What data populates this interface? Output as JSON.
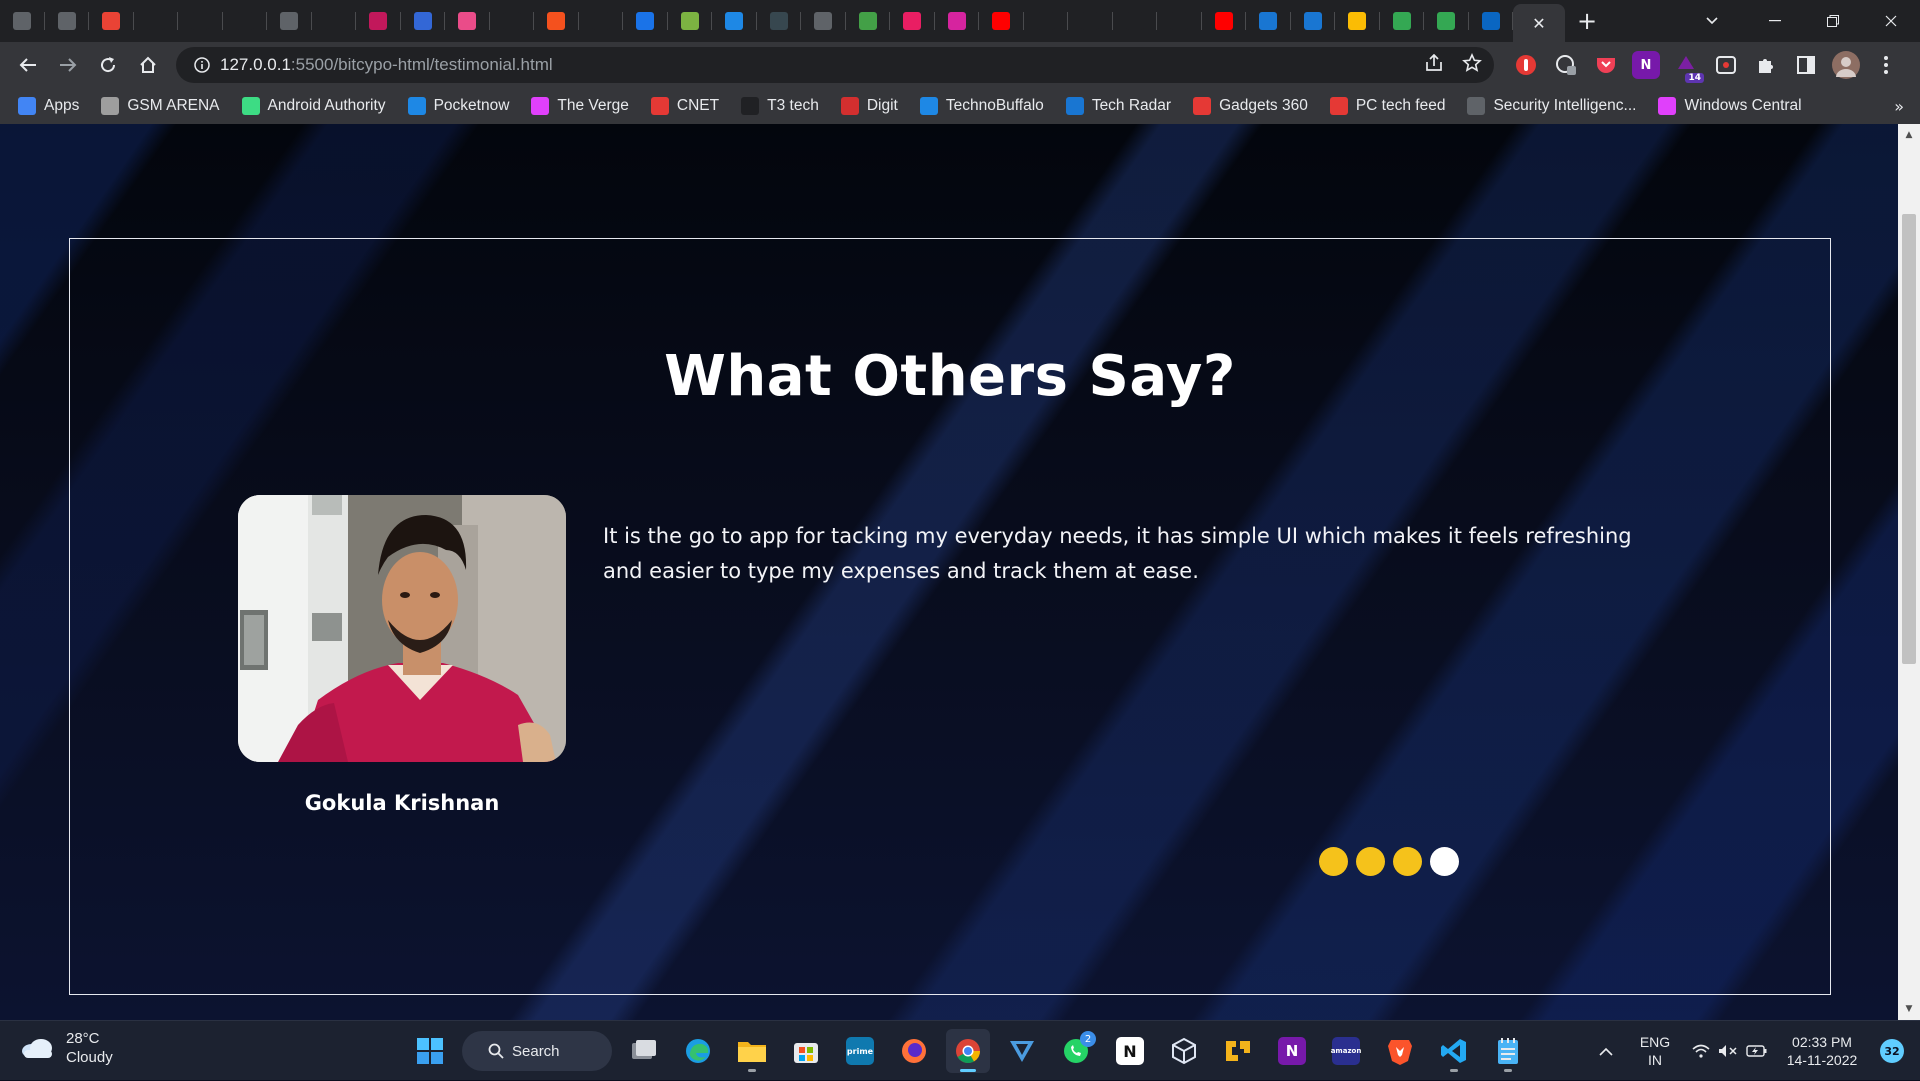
{
  "browser": {
    "tabs": [
      {
        "icon": "tab-favicon-app",
        "color": "#5f6368"
      },
      {
        "icon": "tab-favicon-download",
        "color": "#5f6368"
      },
      {
        "icon": "gmail-icon",
        "color": "#ea4335"
      },
      {
        "icon": "github-icon",
        "color": "#202124"
      },
      {
        "icon": "github-icon",
        "color": "#202124"
      },
      {
        "icon": "github-icon",
        "color": "#202124"
      },
      {
        "icon": "globe-icon",
        "color": "#5f6368"
      },
      {
        "icon": "medium-icon",
        "color": "#202124"
      },
      {
        "icon": "shield-icon",
        "color": "#c2185b"
      },
      {
        "icon": "location-icon",
        "color": "#3367d6"
      },
      {
        "icon": "dribbble-icon",
        "color": "#ea4c89"
      },
      {
        "icon": "z-icon",
        "color": "#202124"
      },
      {
        "icon": "bolt-icon",
        "color": "#f4511e"
      },
      {
        "icon": "dot-icon",
        "color": "#202124"
      },
      {
        "icon": "bag-icon",
        "color": "#1a73e8"
      },
      {
        "icon": "swirl-icon",
        "color": "#7cb342"
      },
      {
        "icon": "flower-icon",
        "color": "#1e88e5"
      },
      {
        "icon": "terminal-icon",
        "color": "#37474f"
      },
      {
        "icon": "news-icon",
        "color": "#5f6368"
      },
      {
        "icon": "j-icon",
        "color": "#43a047"
      },
      {
        "icon": "p-icon",
        "color": "#e91e63"
      },
      {
        "icon": "instagram-icon",
        "color": "#d6249f"
      },
      {
        "icon": "youtube-icon",
        "color": "#ff0000"
      },
      {
        "icon": "blank-icon",
        "color": "#202124"
      },
      {
        "icon": "dash-icon",
        "color": "#202124"
      },
      {
        "icon": "github-icon",
        "color": "#202124"
      },
      {
        "icon": "github-icon",
        "color": "#202124"
      },
      {
        "icon": "youtube-icon",
        "color": "#ff0000"
      },
      {
        "icon": "cloud-icon",
        "color": "#1976d2"
      },
      {
        "icon": "chart-icon",
        "color": "#1976d2"
      },
      {
        "icon": "keep-icon",
        "color": "#fbbc04"
      },
      {
        "icon": "drive-icon",
        "color": "#34a853"
      },
      {
        "icon": "shopping-icon",
        "color": "#34a853"
      },
      {
        "icon": "linkedin-icon",
        "color": "#0a66c2"
      }
    ],
    "active_tab_close": "✕",
    "new_tab": "+",
    "url_host": "127.0.0.1",
    "url_rest": ":5500/bitcypo-html/testimonial.html",
    "bookmarks": [
      {
        "label": "Apps",
        "icon": "apps-grid-icon",
        "color": "#4285f4"
      },
      {
        "label": "GSM ARENA",
        "icon": "gsmarena-icon",
        "color": "#9e9e9e"
      },
      {
        "label": "Android Authority",
        "icon": "android-icon",
        "color": "#3ddc84"
      },
      {
        "label": "Pocketnow",
        "icon": "pocketnow-icon",
        "color": "#1e88e5"
      },
      {
        "label": "The Verge",
        "icon": "verge-icon",
        "color": "#e040fb"
      },
      {
        "label": "CNET",
        "icon": "cnet-icon",
        "color": "#e53935"
      },
      {
        "label": "T3 tech",
        "icon": "t3-icon",
        "color": "#202124"
      },
      {
        "label": "Digit",
        "icon": "digit-icon",
        "color": "#d32f2f"
      },
      {
        "label": "TechnoBuffalo",
        "icon": "technobuffalo-icon",
        "color": "#1e88e5"
      },
      {
        "label": "Tech Radar",
        "icon": "techradar-icon",
        "color": "#1976d2"
      },
      {
        "label": "Gadgets 360",
        "icon": "gadgets360-icon",
        "color": "#e53935"
      },
      {
        "label": "PC tech feed",
        "icon": "pc-icon",
        "color": "#e53935"
      },
      {
        "label": "Security Intelligenc...",
        "icon": "security-icon",
        "color": "#5f6368"
      },
      {
        "label": "Windows Central",
        "icon": "windows-central-icon",
        "color": "#e040fb"
      }
    ],
    "bookmarks_more": "»",
    "extension_badge": "14"
  },
  "page": {
    "heading": "What Others Say?",
    "testimonial": {
      "name": "Gokula Krishnan",
      "quote": "It is the go to app for tacking my everyday needs, it has simple UI which makes it feels refreshing and easier to type my expenses and track them at ease."
    },
    "slider": {
      "count": 4,
      "active_index": 3,
      "dot_color": "#f5c21b",
      "active_color": "#ffffff"
    }
  },
  "taskbar": {
    "weather_temp": "28°C",
    "weather_desc": "Cloudy",
    "search_label": "Search",
    "whatsapp_badge": "2",
    "language_top": "ENG",
    "language_bottom": "IN",
    "time": "02:33 PM",
    "date": "14-11-2022",
    "notification_count": "32"
  }
}
